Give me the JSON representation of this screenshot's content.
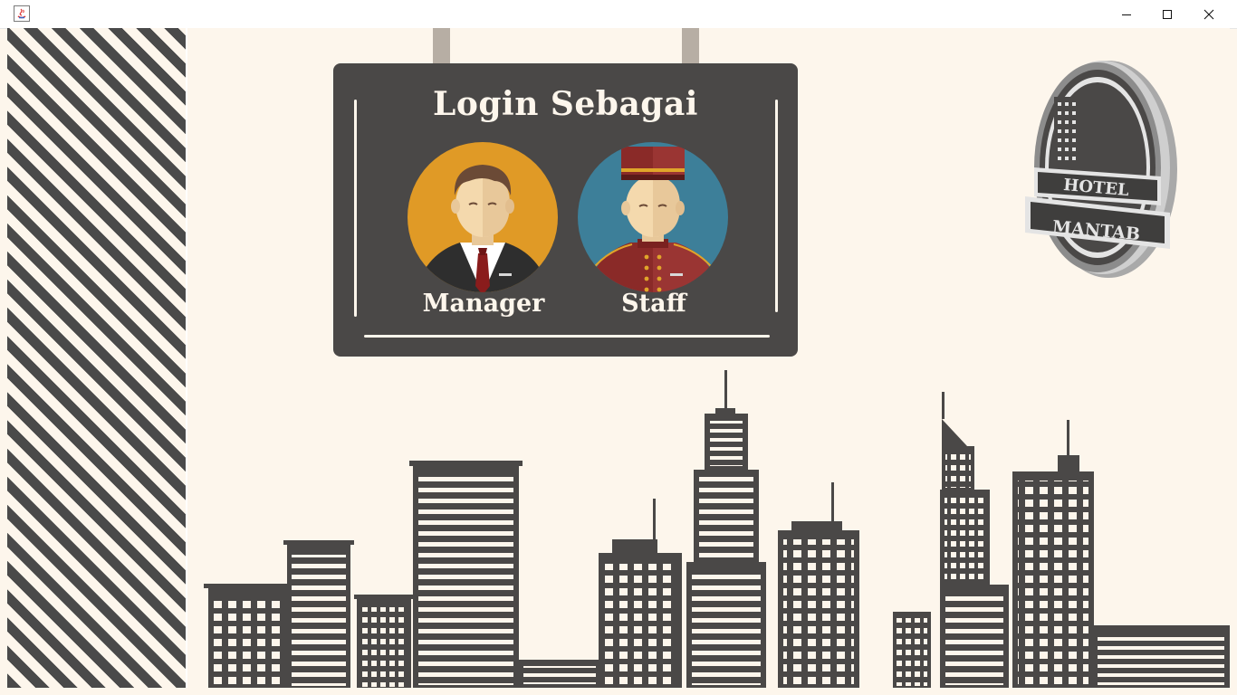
{
  "window": {
    "title": "",
    "controls": {
      "minimize_icon": "minimize-icon",
      "maximize_icon": "maximize-icon",
      "close_icon": "close-icon"
    }
  },
  "sign": {
    "title": "Login Sebagai",
    "roles": [
      {
        "label": "Manager",
        "avatar_icon": "manager-avatar-icon",
        "avatar_bg": "#e09a26"
      },
      {
        "label": "Staff",
        "avatar_icon": "bellboy-staff-avatar-icon",
        "avatar_bg": "#3d7f99"
      }
    ]
  },
  "logo": {
    "line1": "HOTEL",
    "line2": "MANTAB"
  },
  "colors": {
    "background": "#fdf6ec",
    "sign": "#4a4847",
    "buildings": "#4a4847",
    "stripe": "#4a4a4a"
  }
}
